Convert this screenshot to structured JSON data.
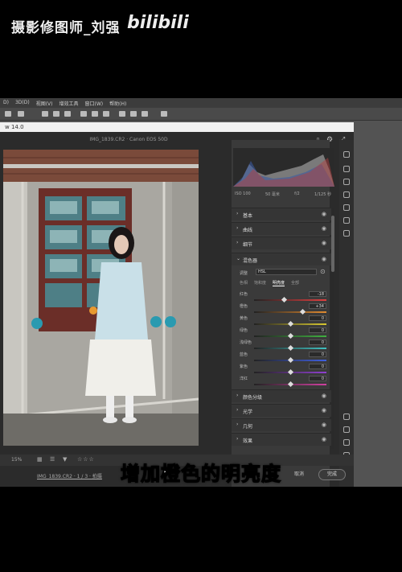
{
  "overlay": {
    "watermark": "摄影修图师_刘强",
    "bilibili_logo": "bilibili",
    "caption": "增加橙色的明亮度"
  },
  "menubar": {
    "items": [
      "D)",
      "3D(D)",
      "视图(V)",
      "增效工具",
      "窗口(W)",
      "帮助(H)"
    ]
  },
  "camera_raw": {
    "title": "w 14.0",
    "file_info": "IMG_1839.CR2 · Canon EOS 50D",
    "exif": [
      "ISO 100",
      "50 毫米",
      "f/2",
      "1/125 秒"
    ],
    "sections_top": [
      {
        "label": "基本"
      },
      {
        "label": "曲线"
      },
      {
        "label": "细节"
      }
    ],
    "color_mixer": {
      "label": "混色器",
      "adjust_label": "调整",
      "adjust_value": "HSL",
      "tabs": [
        "色相",
        "饱和度",
        "明亮度",
        "全部"
      ],
      "active_tab": "明亮度",
      "sliders": [
        {
          "label": "红色",
          "value": "-18",
          "color": "#e04040",
          "pos": 0.41
        },
        {
          "label": "橙色",
          "value": "+34",
          "color": "#e08a30",
          "pos": 0.67
        },
        {
          "label": "黄色",
          "value": "0",
          "color": "#d8c830",
          "pos": 0.5
        },
        {
          "label": "绿色",
          "value": "0",
          "color": "#40b040",
          "pos": 0.5
        },
        {
          "label": "浅绿色",
          "value": "0",
          "color": "#40c0c0",
          "pos": 0.5
        },
        {
          "label": "蓝色",
          "value": "0",
          "color": "#4060e0",
          "pos": 0.5
        },
        {
          "label": "紫色",
          "value": "0",
          "color": "#9040d0",
          "pos": 0.5
        },
        {
          "label": "洋红",
          "value": "0",
          "color": "#d040a0",
          "pos": 0.5
        }
      ]
    },
    "sections_bottom": [
      {
        "label": "颜色分级"
      },
      {
        "label": "光学"
      },
      {
        "label": "几何"
      },
      {
        "label": "效果"
      }
    ],
    "zoom": "15%",
    "file_link": "IMG_1839.CR2 · 1 / 3 · 拍摄",
    "cancel_label": "取消",
    "done_label": "完成"
  }
}
